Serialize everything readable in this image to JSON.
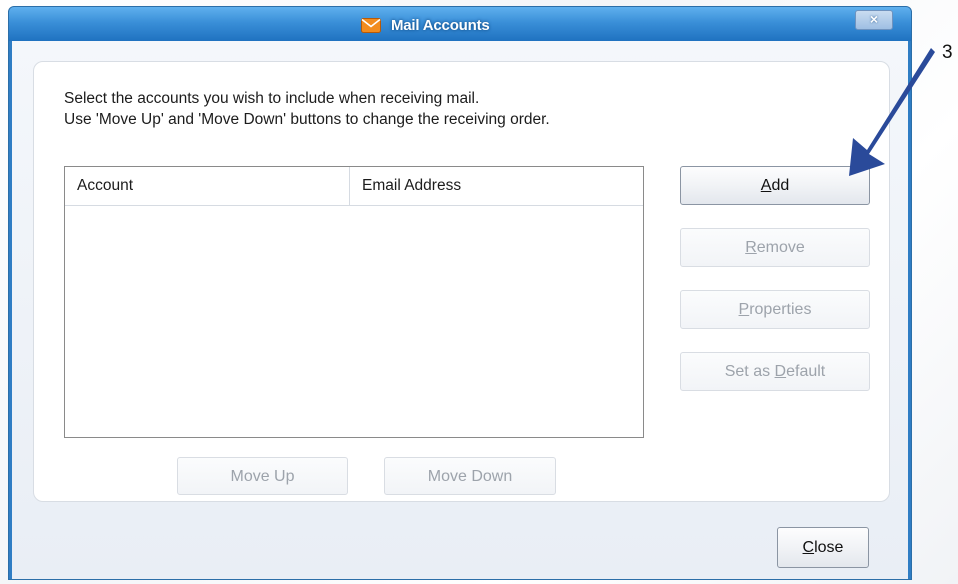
{
  "window": {
    "title": "Mail Accounts",
    "close_glyph": "×"
  },
  "instructions": {
    "line1": "Select the accounts you wish to include when receiving mail.",
    "line2": "Use 'Move Up' and 'Move Down' buttons to change the receiving order."
  },
  "list": {
    "columns": [
      "Account",
      "Email Address"
    ],
    "rows": []
  },
  "buttons": {
    "add": {
      "pre": "",
      "key": "A",
      "post": "dd"
    },
    "remove": {
      "pre": "",
      "key": "R",
      "post": "emove"
    },
    "properties": {
      "pre": "",
      "key": "P",
      "post": "roperties"
    },
    "set_default": {
      "pre": "Set as ",
      "key": "D",
      "post": "efault"
    },
    "move_up": "Move Up",
    "move_down": "Move Down",
    "close": {
      "pre": "",
      "key": "C",
      "post": "lose"
    }
  },
  "annotation": {
    "step": "3"
  },
  "colors": {
    "titlebar": "#3a8fd8",
    "arrow": "#2a4a9a"
  }
}
